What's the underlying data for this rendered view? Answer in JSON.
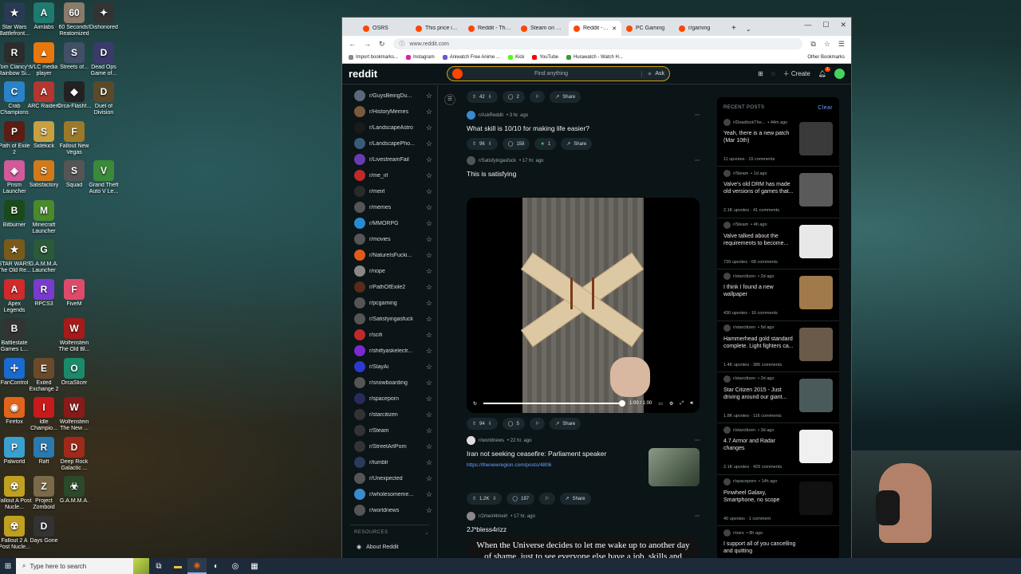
{
  "desktop": {
    "icons": [
      {
        "label": "Star Wars Battlefront...",
        "color": "#2a3a55",
        "glyph": "★"
      },
      {
        "label": "Aimlabs",
        "color": "#1f7a6f",
        "glyph": "A"
      },
      {
        "label": "60 Seconds! Reatomized",
        "color": "#8a7b6a",
        "glyph": "60"
      },
      {
        "label": "Dishonored",
        "color": "#333",
        "glyph": "✦"
      },
      {
        "label": "Tom Clancy's Rainbow Si...",
        "color": "#2c2c2c",
        "glyph": "R"
      },
      {
        "label": "VLC media player",
        "color": "#e8770e",
        "glyph": "▲"
      },
      {
        "label": "Streets of...",
        "color": "#415066",
        "glyph": "S"
      },
      {
        "label": "Dead Ops Game of...",
        "color": "#3b3b6b",
        "glyph": "D"
      },
      {
        "label": "Crab Champions",
        "color": "#2a82c8",
        "glyph": "C"
      },
      {
        "label": "ARC Raiders",
        "color": "#b4362e",
        "glyph": "A"
      },
      {
        "label": "Orca-Flashf...",
        "color": "#222",
        "glyph": "◆"
      },
      {
        "label": "Duel of Division",
        "color": "#5a4a2a",
        "glyph": "D"
      },
      {
        "label": "Path of Exile 2",
        "color": "#5c1d14",
        "glyph": "P"
      },
      {
        "label": "Sidekick",
        "color": "#c8a040",
        "glyph": "S"
      },
      {
        "label": "Fallout New Vegas",
        "color": "#9a7a2a",
        "glyph": "F"
      },
      {
        "label": "Prism Launcher",
        "color": "#d05a9a",
        "glyph": "◈"
      },
      {
        "label": "Satisfactory",
        "color": "#d07a1a",
        "glyph": "S"
      },
      {
        "label": "Squad",
        "color": "#555",
        "glyph": "S"
      },
      {
        "label": "Grand Theft Auto V Le...",
        "color": "#3a8a3a",
        "glyph": "V"
      },
      {
        "label": "Bitburner",
        "color": "#1a4a1a",
        "glyph": "B"
      },
      {
        "label": "Minecraft Launcher",
        "color": "#4a8a2a",
        "glyph": "M"
      },
      {
        "label": "STAR WARS The Old Re...",
        "color": "#7a5a1a",
        "glyph": "★"
      },
      {
        "label": "G.A.M.M.A. Launcher",
        "color": "#2a5a3a",
        "glyph": "G"
      },
      {
        "label": "Apex Legends",
        "color": "#d02a2a",
        "glyph": "A"
      },
      {
        "label": "RPCS3",
        "color": "#7a3ad0",
        "glyph": "R"
      },
      {
        "label": "FiveM",
        "color": "#e04a6a",
        "glyph": "F"
      },
      {
        "label": "Battlestate Games L...",
        "color": "#333",
        "glyph": "B"
      },
      {
        "label": "Wolfenstein The Old Bl...",
        "color": "#a81a1a",
        "glyph": "W"
      },
      {
        "label": "FanControl",
        "color": "#1a6ad0",
        "glyph": "✢"
      },
      {
        "label": "Exiled Exchange 2",
        "color": "#6a4a2a",
        "glyph": "E"
      },
      {
        "label": "OrcaSlicer",
        "color": "#1a8a6a",
        "glyph": "O"
      },
      {
        "label": "Firefox",
        "color": "#e0651a",
        "glyph": "◉"
      },
      {
        "label": "Idle Champio...",
        "color": "#c81a1a",
        "glyph": "I"
      },
      {
        "label": "Wolfenstein The New ...",
        "color": "#8a1a1a",
        "glyph": "W"
      },
      {
        "label": "Palworld",
        "color": "#3aa0d0",
        "glyph": "P"
      },
      {
        "label": "Raft",
        "color": "#2a7ab0",
        "glyph": "R"
      },
      {
        "label": "Deep Rock Galactic ...",
        "color": "#a02a1a",
        "glyph": "D"
      },
      {
        "label": "Fallout A Post Nucle...",
        "color": "#c0a020",
        "glyph": "☢"
      },
      {
        "label": "Project Zomboid",
        "color": "#7a6a4a",
        "glyph": "Z"
      },
      {
        "label": "G.A.M.M.A.",
        "color": "#2a4a2a",
        "glyph": "☣"
      },
      {
        "label": "Fallout 2 A Post Nucle...",
        "color": "#c0a020",
        "glyph": "☢"
      },
      {
        "label": "Days Gone",
        "color": "#333",
        "glyph": "D"
      }
    ]
  },
  "browser": {
    "tabs": [
      {
        "label": "OSRS"
      },
      {
        "label": "This price increas"
      },
      {
        "label": "Reddit - The hear"
      },
      {
        "label": "Steam on Reddit"
      },
      {
        "label": "Reddit - The h"
      },
      {
        "label": "PC Gaming"
      },
      {
        "label": "r/gaming"
      }
    ],
    "url": "www.reddit.com",
    "bookmarks": [
      {
        "label": "Import bookmarks...",
        "color": "#888"
      },
      {
        "label": "Instagram",
        "color": "#d6249f"
      },
      {
        "label": "Aniwatch Free Anime ...",
        "color": "#6a5acd"
      },
      {
        "label": "Kick",
        "color": "#53fc18"
      },
      {
        "label": "YouTube",
        "color": "#ff0000"
      },
      {
        "label": "Hurawatch - Watch H...",
        "color": "#3a9a3a"
      }
    ],
    "other_bookmarks": "Other Bookmarks"
  },
  "reddit": {
    "logo": "reddit",
    "search_placeholder": "Find anything",
    "ask_label": "Ask",
    "create_label": "Create",
    "notif_count": "1",
    "sidebar": {
      "items": [
        {
          "name": "r/GuysBeingDu...",
          "color": "#5a6a7a"
        },
        {
          "name": "r/HistoryMemes",
          "color": "#7a5a3a"
        },
        {
          "name": "r/LandscapeAstro",
          "color": "#1a1a1a"
        },
        {
          "name": "r/LandscapePho...",
          "color": "#3a5a7a"
        },
        {
          "name": "r/LivestreamFail",
          "color": "#6a3ab0"
        },
        {
          "name": "r/me_irl",
          "color": "#c02a2a"
        },
        {
          "name": "r/meirl",
          "color": "#2a2a2a"
        },
        {
          "name": "r/memes",
          "color": "#555"
        },
        {
          "name": "r/MMORPG",
          "color": "#2a8ad0"
        },
        {
          "name": "r/movies",
          "color": "#555"
        },
        {
          "name": "r/NatureIsFucki...",
          "color": "#e05a1a"
        },
        {
          "name": "r/nope",
          "color": "#888"
        },
        {
          "name": "r/PathOfExile2",
          "color": "#5a2a1a"
        },
        {
          "name": "r/pcgaming",
          "color": "#555"
        },
        {
          "name": "r/Satisfyingasfuck",
          "color": "#555"
        },
        {
          "name": "r/scifi",
          "color": "#c02a2a"
        },
        {
          "name": "r/shittyaskelectr...",
          "color": "#7a2ad0"
        },
        {
          "name": "r/SlayAi",
          "color": "#2a3ad0"
        },
        {
          "name": "r/snowboarding",
          "color": "#555"
        },
        {
          "name": "r/spaceporn",
          "color": "#2a2a5a"
        },
        {
          "name": "r/starcitizen",
          "color": "#333"
        },
        {
          "name": "r/Steam",
          "color": "#333"
        },
        {
          "name": "r/StreetArtPorn",
          "color": "#333"
        },
        {
          "name": "r/tumblr",
          "color": "#2a3a5a"
        },
        {
          "name": "r/Unexpected",
          "color": "#555"
        },
        {
          "name": "r/wholesomeme...",
          "color": "#3a8ad0"
        },
        {
          "name": "r/worldnews",
          "color": "#555"
        }
      ],
      "resources_label": "RESOURCES",
      "about_label": "About Reddit"
    },
    "feed": {
      "top_actions": {
        "votes": "42",
        "comments": "2",
        "share": "Share"
      },
      "posts": [
        {
          "sub": "r/AskReddit",
          "time": "• 3 hr. ago",
          "title": "What skill is 10/10 for making life easier?",
          "votes": "96",
          "comments": "158",
          "award": "1",
          "share": "Share"
        },
        {
          "sub": "r/Satisfyingasfuck",
          "time": "• 17 hr. ago",
          "title": "This is satisfying",
          "video_time": "1:00 / 1:00",
          "votes": "94",
          "comments": "5",
          "share": "Share"
        },
        {
          "sub": "r/worldnews",
          "time": "• 22 hr. ago",
          "title": "Iran not seeking ceasefire: Parliament speaker",
          "link": "https://thenewregion.com/posts/4806",
          "votes": "1.2K",
          "comments": "197",
          "share": "Share"
        },
        {
          "sub": "r/2meirl4meirl",
          "time": "• 17 hr. ago",
          "title": "2J*bless4rizz",
          "meme_text": "When the Universe decides to let me wake up to another day of shame, just to see everyone else have a job, skills and purpose in life"
        }
      ]
    },
    "recent": {
      "heading": "RECENT POSTS",
      "clear": "Clear",
      "items": [
        {
          "sub": "r/DeadlockThe...",
          "time": "• 44m ago",
          "title": "Yeah, there is a new patch (Mar 10th)",
          "stats": "11 upvotes · 15 comments",
          "thumb": "#3a3a3a"
        },
        {
          "sub": "r/Steam",
          "time": "• 1d ago",
          "title": "Valve's old DRM has made old versions of games that...",
          "stats": "2.1K upvotes · 41 comments",
          "thumb": "#5a5a5a"
        },
        {
          "sub": "r/Steam",
          "time": "• 4h ago",
          "title": "Valve talked about the requirements to become...",
          "stats": "739 upvotes · 68 comments",
          "thumb": "#e8e8e8"
        },
        {
          "sub": "r/starcitizen",
          "time": "• 2d ago",
          "title": "I think I found a new wallpaper",
          "stats": "430 upvotes · 16 comments",
          "thumb": "#a07a4a"
        },
        {
          "sub": "r/starcitizen",
          "time": "• 5d ago",
          "title": "Hammerhead gold standard complete. Light fighters ca...",
          "stats": "1.4K upvotes · 386 comments",
          "thumb": "#6a5a4a"
        },
        {
          "sub": "r/starcitizen",
          "time": "• 2d ago",
          "title": "Star Citizen 2015 - Just driving around our giant...",
          "stats": "1.8K upvotes · 116 comments",
          "thumb": "#4a5a5a"
        },
        {
          "sub": "r/starcitizen",
          "time": "• 3d ago",
          "title": "4.7 Armor and Radar changes",
          "stats": "2.1K upvotes · 429 comments",
          "thumb": "#f0f0f0"
        },
        {
          "sub": "r/spaceporn",
          "time": "• 14h ago",
          "title": "Pinwheel Galaxy, Smartphone, no scope",
          "stats": "40 upvotes · 1 comment",
          "thumb": "#111"
        },
        {
          "sub": "r/osrs",
          "time": "• 8h ago",
          "title": "I support all of you cancelling and quitting",
          "stats": "",
          "thumb": "#000"
        }
      ]
    }
  },
  "taskbar": {
    "search_placeholder": "Type here to search"
  }
}
